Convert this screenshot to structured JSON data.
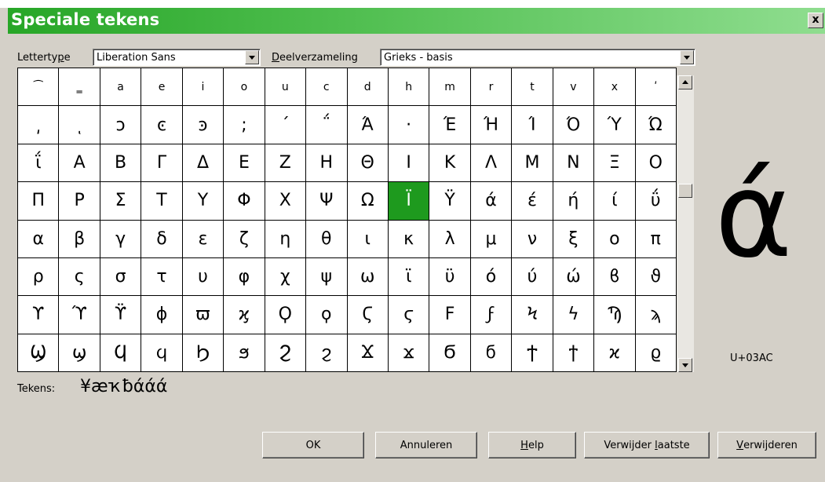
{
  "dialog": {
    "title": "Speciale tekens",
    "close_label": "x"
  },
  "font": {
    "label_pre": "Letterty",
    "label_key": "p",
    "label_post": "e",
    "value": "Liberation Sans"
  },
  "subset": {
    "label_key": "D",
    "label_post": "eelverzameling",
    "value": "Grieks - basis"
  },
  "grid": {
    "selected_index": 57,
    "rows": [
      [
        "⁀",
        "‗",
        "a",
        "e",
        "i",
        "o",
        "u",
        "c",
        "d",
        "h",
        "m",
        "r",
        "t",
        "v",
        "x",
        "ʹ"
      ],
      [
        "͵",
        "ͺ",
        "ͻ",
        "ͼ",
        "ͽ",
        ";",
        "΄",
        "΅",
        "Ά",
        "·",
        "Έ",
        "Ή",
        "Ί",
        "Ό",
        "Ύ",
        "Ώ"
      ],
      [
        "ΐ",
        "Α",
        "Β",
        "Γ",
        "Δ",
        "Ε",
        "Ζ",
        "Η",
        "Θ",
        "Ι",
        "Κ",
        "Λ",
        "Μ",
        "Ν",
        "Ξ",
        "Ο"
      ],
      [
        "Π",
        "Ρ",
        "Σ",
        "Τ",
        "Υ",
        "Φ",
        "Χ",
        "Ψ",
        "Ω",
        "Ϊ",
        "Ϋ",
        "ά",
        "έ",
        "ή",
        "ί",
        "ΰ"
      ],
      [
        "α",
        "β",
        "γ",
        "δ",
        "ε",
        "ζ",
        "η",
        "θ",
        "ι",
        "κ",
        "λ",
        "μ",
        "ν",
        "ξ",
        "ο",
        "π"
      ],
      [
        "ρ",
        "ς",
        "σ",
        "τ",
        "υ",
        "φ",
        "χ",
        "ψ",
        "ω",
        "ϊ",
        "ϋ",
        "ό",
        "ύ",
        "ώ",
        "ϐ",
        "ϑ"
      ],
      [
        "ϒ",
        "ϓ",
        "ϔ",
        "ϕ",
        "ϖ",
        "ϗ",
        "Ϙ",
        "ϙ",
        "Ϛ",
        "ϛ",
        "Ϝ",
        "ϝ",
        "Ϟ",
        "ϟ",
        "Ϡ",
        "ϡ"
      ],
      [
        "Ϣ",
        "ϣ",
        "Ϥ",
        "ϥ",
        "Ϧ",
        "ϧ",
        "Ϩ",
        "ϩ",
        "Ϫ",
        "ϫ",
        "Ϭ",
        "ϭ",
        "Ϯ",
        "ϯ",
        "ϰ",
        "ϱ"
      ]
    ],
    "small_cells": [
      0,
      1,
      2,
      3,
      4,
      5,
      6,
      7,
      8,
      9,
      10,
      11,
      12,
      13,
      14,
      15
    ]
  },
  "preview": {
    "char": "ά",
    "code": "U+03AC"
  },
  "tekens": {
    "label": "Tekens:",
    "value": "¥ӕҡƀάάά"
  },
  "buttons": {
    "ok": "OK",
    "cancel": "Annuleren",
    "help_key": "H",
    "help_post": "elp",
    "remove_last_pre": "Verwijder ",
    "remove_last_key": "l",
    "remove_last_post": "aatste",
    "remove_key": "V",
    "remove_post": "erwijderen"
  },
  "colors": {
    "title_gradient_start": "#27a627",
    "title_gradient_end": "#8fdd8f",
    "selection": "#1e9a1e",
    "dialog_bg": "#d4d0c8"
  }
}
